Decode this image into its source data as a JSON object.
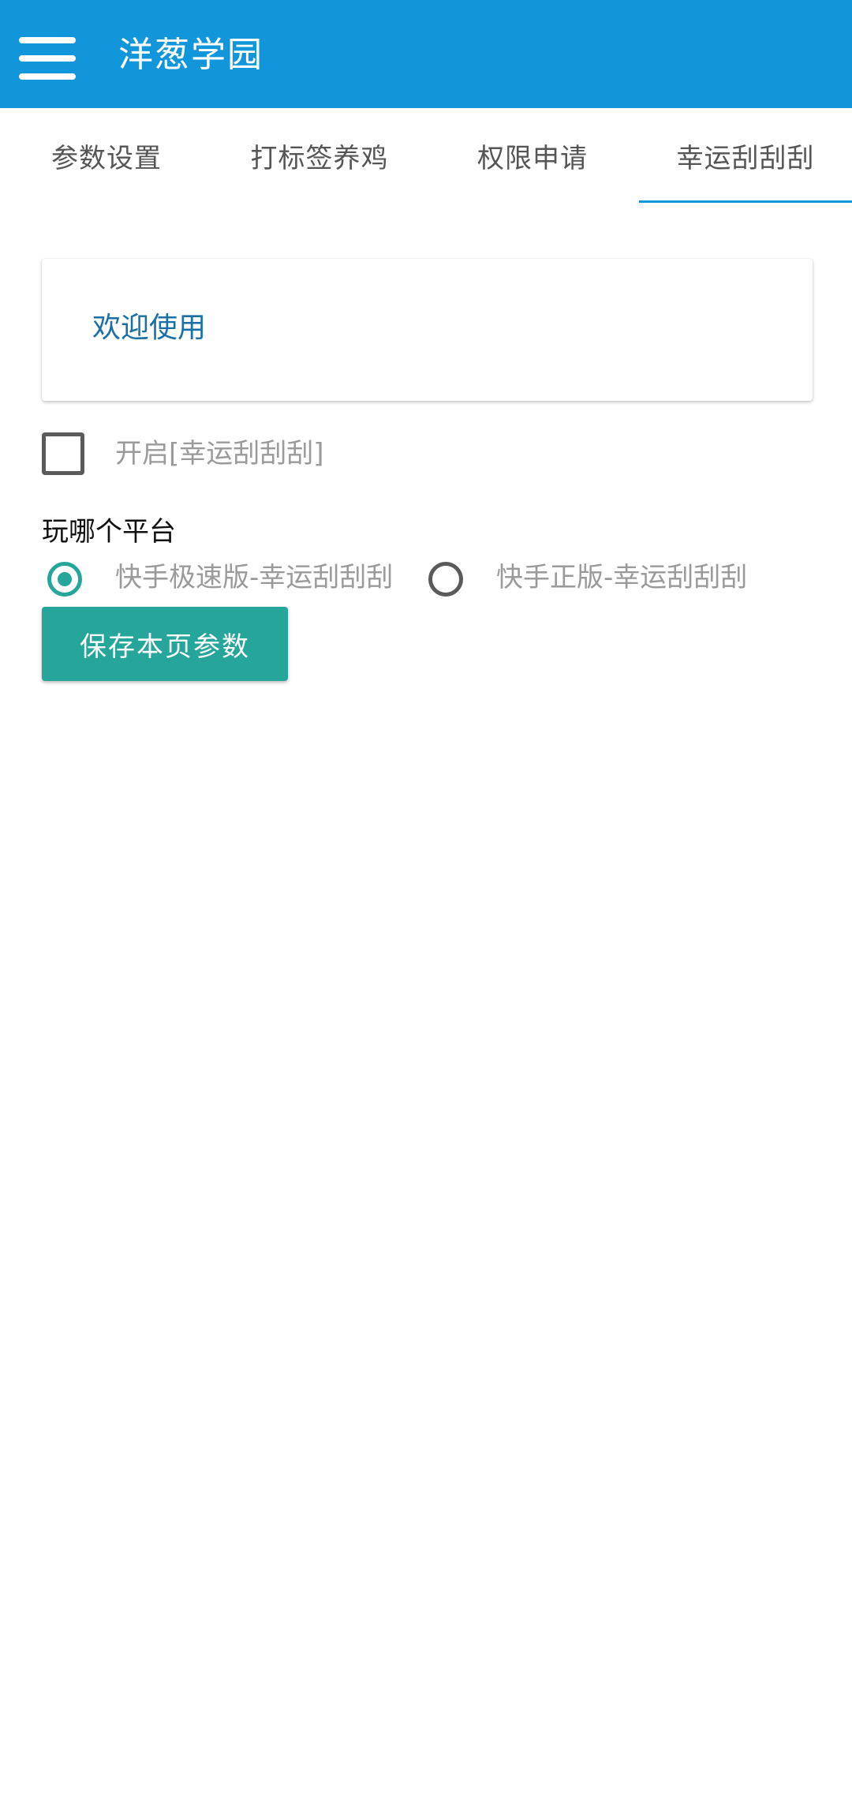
{
  "appbar": {
    "menu_icon": "hamburger-menu-icon",
    "title": "洋葱学园",
    "color": "#1296db"
  },
  "tabs": {
    "items": [
      {
        "label": "参数设置"
      },
      {
        "label": "打标签养鸡"
      },
      {
        "label": "权限申请"
      },
      {
        "label": "幸运刮刮刮"
      }
    ],
    "active_index": 3,
    "active_label": "幸运刮刮刮"
  },
  "card": {
    "text": "欢迎使用"
  },
  "enable_option": {
    "label": "开启[幸运刮刮刮]",
    "checked": false
  },
  "platform": {
    "question": "玩哪个平台",
    "options": [
      {
        "label": "快手极速版-幸运刮刮刮",
        "selected": true
      },
      {
        "label": "快手正版-幸运刮刮刮",
        "selected": false
      }
    ],
    "accent_color": "#26a69a"
  },
  "actions": {
    "save_label": "保存本页参数"
  }
}
